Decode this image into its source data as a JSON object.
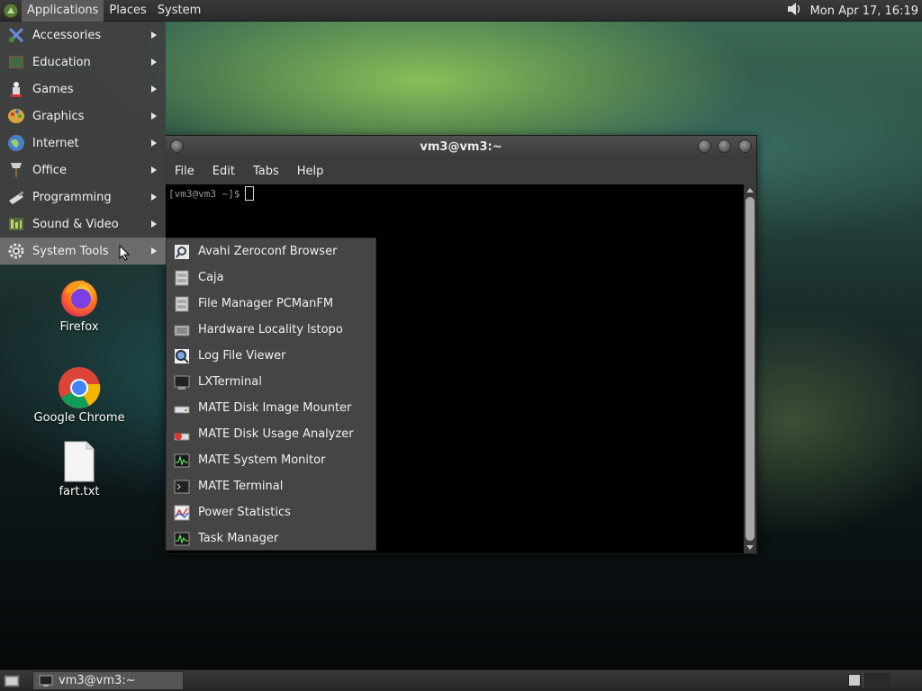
{
  "top_panel": {
    "menus": [
      "Applications",
      "Places",
      "System"
    ],
    "clock": "Mon Apr 17, 16:19"
  },
  "app_menu": {
    "items": [
      {
        "label": "Accessories",
        "icon": "accessories-icon"
      },
      {
        "label": "Education",
        "icon": "education-icon"
      },
      {
        "label": "Games",
        "icon": "games-icon"
      },
      {
        "label": "Graphics",
        "icon": "graphics-icon"
      },
      {
        "label": "Internet",
        "icon": "internet-icon"
      },
      {
        "label": "Office",
        "icon": "office-icon"
      },
      {
        "label": "Programming",
        "icon": "programming-icon"
      },
      {
        "label": "Sound & Video",
        "icon": "sound-video-icon"
      },
      {
        "label": "System Tools",
        "icon": "system-tools-icon"
      }
    ]
  },
  "submenu": {
    "items": [
      {
        "label": "Avahi Zeroconf Browser"
      },
      {
        "label": "Caja"
      },
      {
        "label": "File Manager PCManFM"
      },
      {
        "label": "Hardware Locality lstopo"
      },
      {
        "label": "Log File Viewer"
      },
      {
        "label": "LXTerminal"
      },
      {
        "label": "MATE Disk Image Mounter"
      },
      {
        "label": "MATE Disk Usage Analyzer"
      },
      {
        "label": "MATE System Monitor"
      },
      {
        "label": "MATE Terminal"
      },
      {
        "label": "Power Statistics"
      },
      {
        "label": "Task Manager"
      }
    ]
  },
  "terminal": {
    "title": "vm3@vm3:~",
    "menus": [
      "File",
      "Edit",
      "Tabs",
      "Help"
    ],
    "prompt": "[vm3@vm3 ~]$"
  },
  "desktop": {
    "icons": [
      {
        "label": "Firefox"
      },
      {
        "label": "Google Chrome"
      },
      {
        "label": "fart.txt"
      }
    ]
  },
  "taskbar": {
    "window_title": "vm3@vm3:~"
  },
  "colors": {
    "panel": "#2e2e2e",
    "menu_bg": "#404040",
    "highlight": "#6b6b6b"
  }
}
